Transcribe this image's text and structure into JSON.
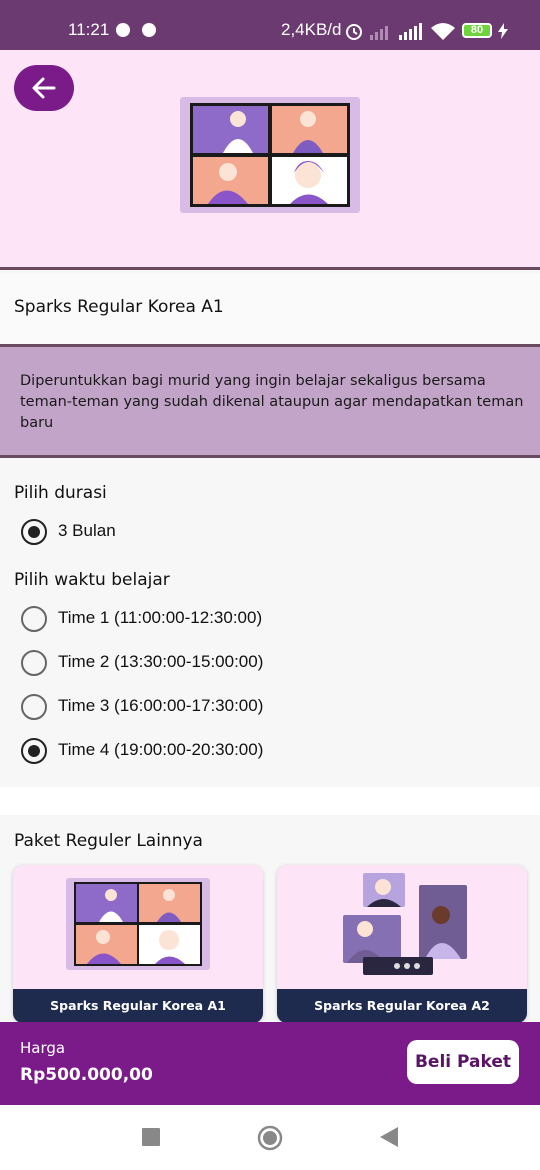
{
  "status_bar": {
    "time": "11:21",
    "network_speed": "2,4KB/d",
    "battery_level": "80",
    "icons": [
      "notification-icon",
      "notification-icon",
      "alarm-icon",
      "signal-off-icon",
      "signal-icon",
      "wifi-icon",
      "battery-icon",
      "charging-icon"
    ]
  },
  "header": {
    "back_icon": "arrow-left-icon",
    "illustration": "video-call-illustration"
  },
  "package": {
    "title": "Sparks Regular Korea A1",
    "description": "Diperuntukkan bagi murid yang ingin belajar sekaligus bersama teman-teman yang sudah dikenal ataupun agar mendapatkan teman baru"
  },
  "duration": {
    "label": "Pilih durasi",
    "options": [
      {
        "label": "3 Bulan",
        "selected": true
      }
    ]
  },
  "schedule": {
    "label": "Pilih waktu belajar",
    "options": [
      {
        "label": "Time 1 (11:00:00-12:30:00)",
        "selected": false
      },
      {
        "label": "Time 2 (13:30:00-15:00:00)",
        "selected": false
      },
      {
        "label": "Time 3 (16:00:00-17:30:00)",
        "selected": false
      },
      {
        "label": "Time 4 (19:00:00-20:30:00)",
        "selected": true
      }
    ]
  },
  "other_packages": {
    "title": "Paket Reguler Lainnya",
    "cards": [
      {
        "name": "Sparks Regular Korea A1",
        "illustration": "video-call-illustration"
      },
      {
        "name": "Sparks Regular Korea A2",
        "illustration": "online-meeting-illustration"
      }
    ]
  },
  "footer": {
    "price_label": "Harga",
    "price_value": "Rp500.000,00",
    "buy_label": "Beli Paket"
  },
  "nav_bar": {
    "icons": [
      "recent-apps-icon",
      "home-icon",
      "back-icon"
    ]
  },
  "colors": {
    "status_bar": "#6b3a70",
    "header_bg": "#fde4f7",
    "accent": "#7b1b89",
    "desc_bg": "#c3a4c9",
    "card_caption": "#1f2a4f"
  }
}
